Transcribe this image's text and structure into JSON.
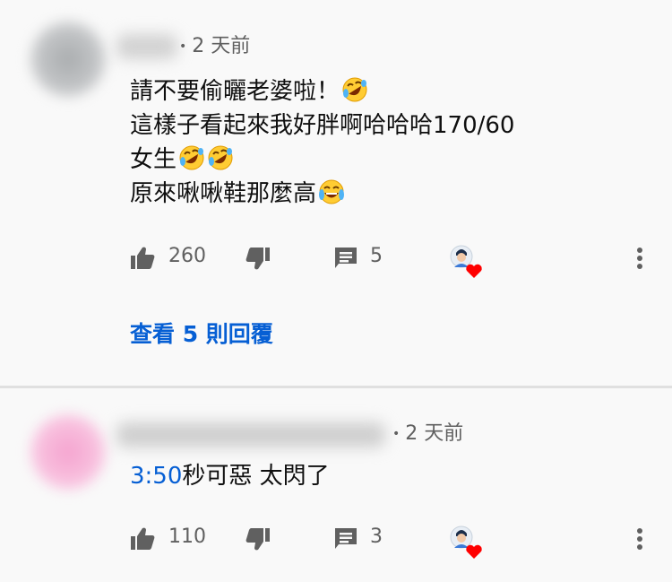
{
  "comments": [
    {
      "time": "2 天前",
      "lines": [
        "請不要偷曬老婆啦！",
        "這樣子看起來我好胖啊哈哈哈170/60",
        "女生",
        "原來啾啾鞋那麼高"
      ],
      "emojis": [
        "rolling-on-floor-laughing",
        "rolling-on-floor-laughing",
        "face-with-tears-of-joy"
      ],
      "likes": "260",
      "replies": "5",
      "view_replies_label": "查看 5 則回覆"
    },
    {
      "time": "2 天前",
      "timestamp_link": "3:50",
      "text_after_timestamp": "秒可惡 太閃了",
      "likes": "110",
      "replies": "3"
    }
  ],
  "icons": {
    "like": "thumbs-up-icon",
    "dislike": "thumbs-down-icon",
    "reply": "comment-icon",
    "creator_heart": "creator-heart-icon",
    "more": "more-vert-icon"
  },
  "colors": {
    "link": "#065fd4",
    "secondary_text": "#606060",
    "background": "#f9f9f9",
    "heart": "#ff0000"
  }
}
